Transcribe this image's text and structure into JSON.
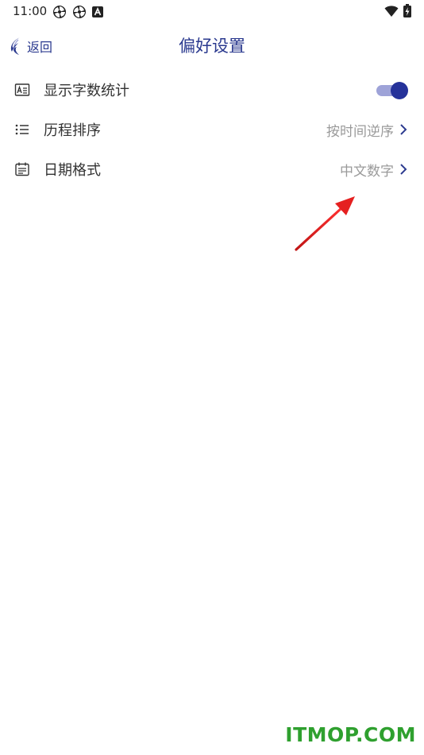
{
  "status_bar": {
    "time": "11:00",
    "icons_left": [
      "pinwheel-icon",
      "pinwheel-icon",
      "text-a-icon"
    ],
    "icons_right": [
      "wifi-icon",
      "battery-charging-icon"
    ]
  },
  "header": {
    "back_label": "返回",
    "title": "偏好设置",
    "accent_color": "#2b3a8f"
  },
  "settings": [
    {
      "icon": "word-count-icon",
      "label": "显示字数统计",
      "control": "toggle",
      "enabled": true
    },
    {
      "icon": "list-icon",
      "label": "历程排序",
      "value": "按时间逆序",
      "control": "chevron"
    },
    {
      "icon": "calendar-icon",
      "label": "日期格式",
      "value": "中文数字",
      "control": "chevron"
    }
  ],
  "annotation": {
    "type": "red-arrow",
    "color": "#e02020"
  },
  "watermark": "ITMOP.COM"
}
